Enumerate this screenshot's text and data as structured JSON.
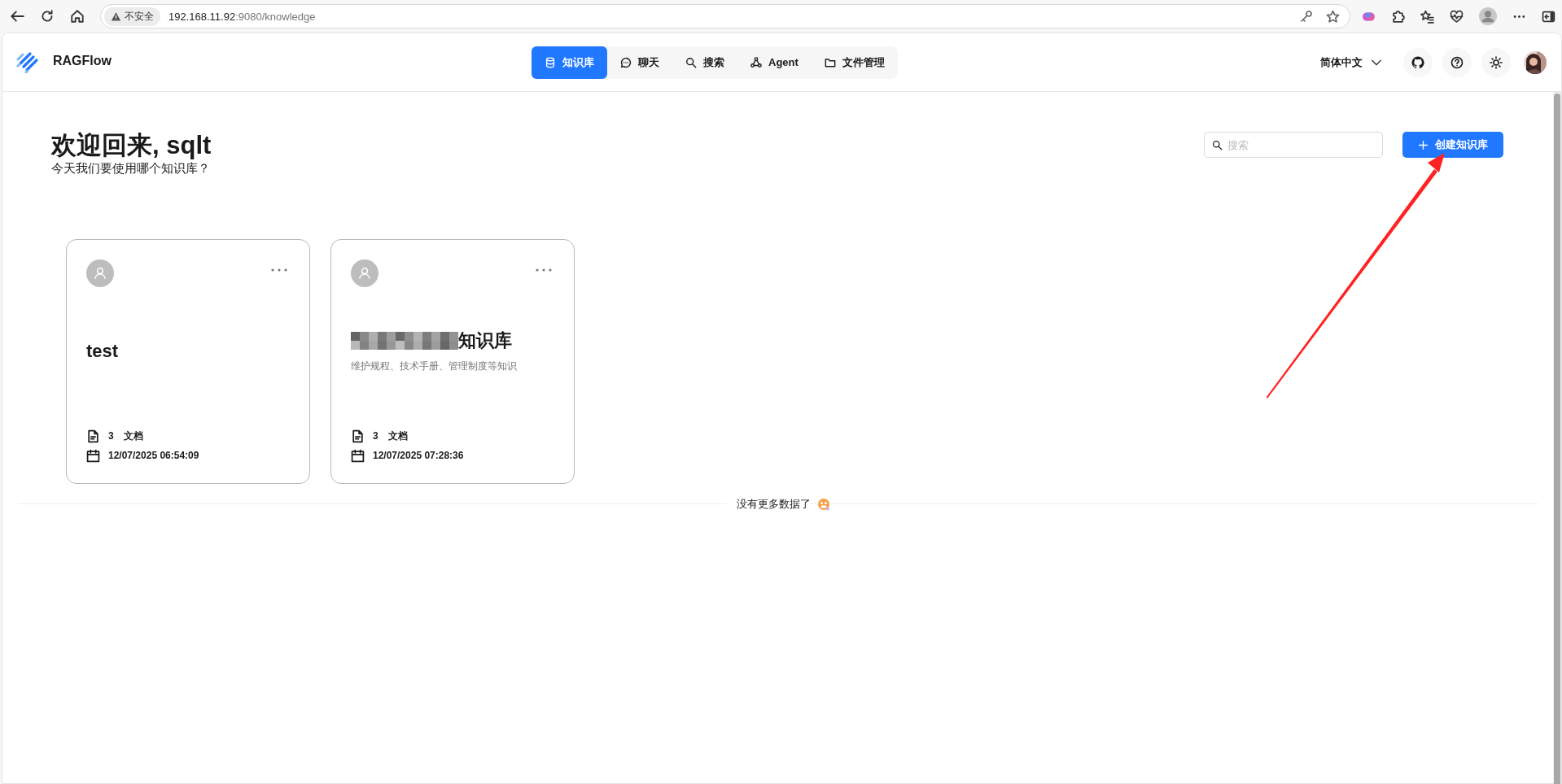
{
  "browser": {
    "security_label": "不安全",
    "url_host": "192.168.11.92",
    "url_rest": ":9080/knowledge"
  },
  "app": {
    "name": "RAGFlow"
  },
  "nav": [
    {
      "label": "知识库",
      "selected": true
    },
    {
      "label": "聊天",
      "selected": false
    },
    {
      "label": "搜索",
      "selected": false
    },
    {
      "label": "Agent",
      "selected": false
    },
    {
      "label": "文件管理",
      "selected": false
    }
  ],
  "language": "简体中文",
  "welcome": {
    "title": "欢迎回来, sqlt",
    "subtitle": "今天我们要使用哪个知识库？"
  },
  "search": {
    "placeholder": "搜索"
  },
  "create_button": "创建知识库",
  "cards": [
    {
      "title": "test",
      "redacted": false,
      "doc_count": "3",
      "doc_label": "文档",
      "date": "12/07/2025 06:54:09"
    },
    {
      "title": "知识库",
      "redacted": true,
      "description": "维护规程、技术手册、管理制度等知识",
      "doc_count": "3",
      "doc_label": "文档",
      "date": "12/07/2025 07:28:36"
    }
  ],
  "end_message": "没有更多数据了"
}
